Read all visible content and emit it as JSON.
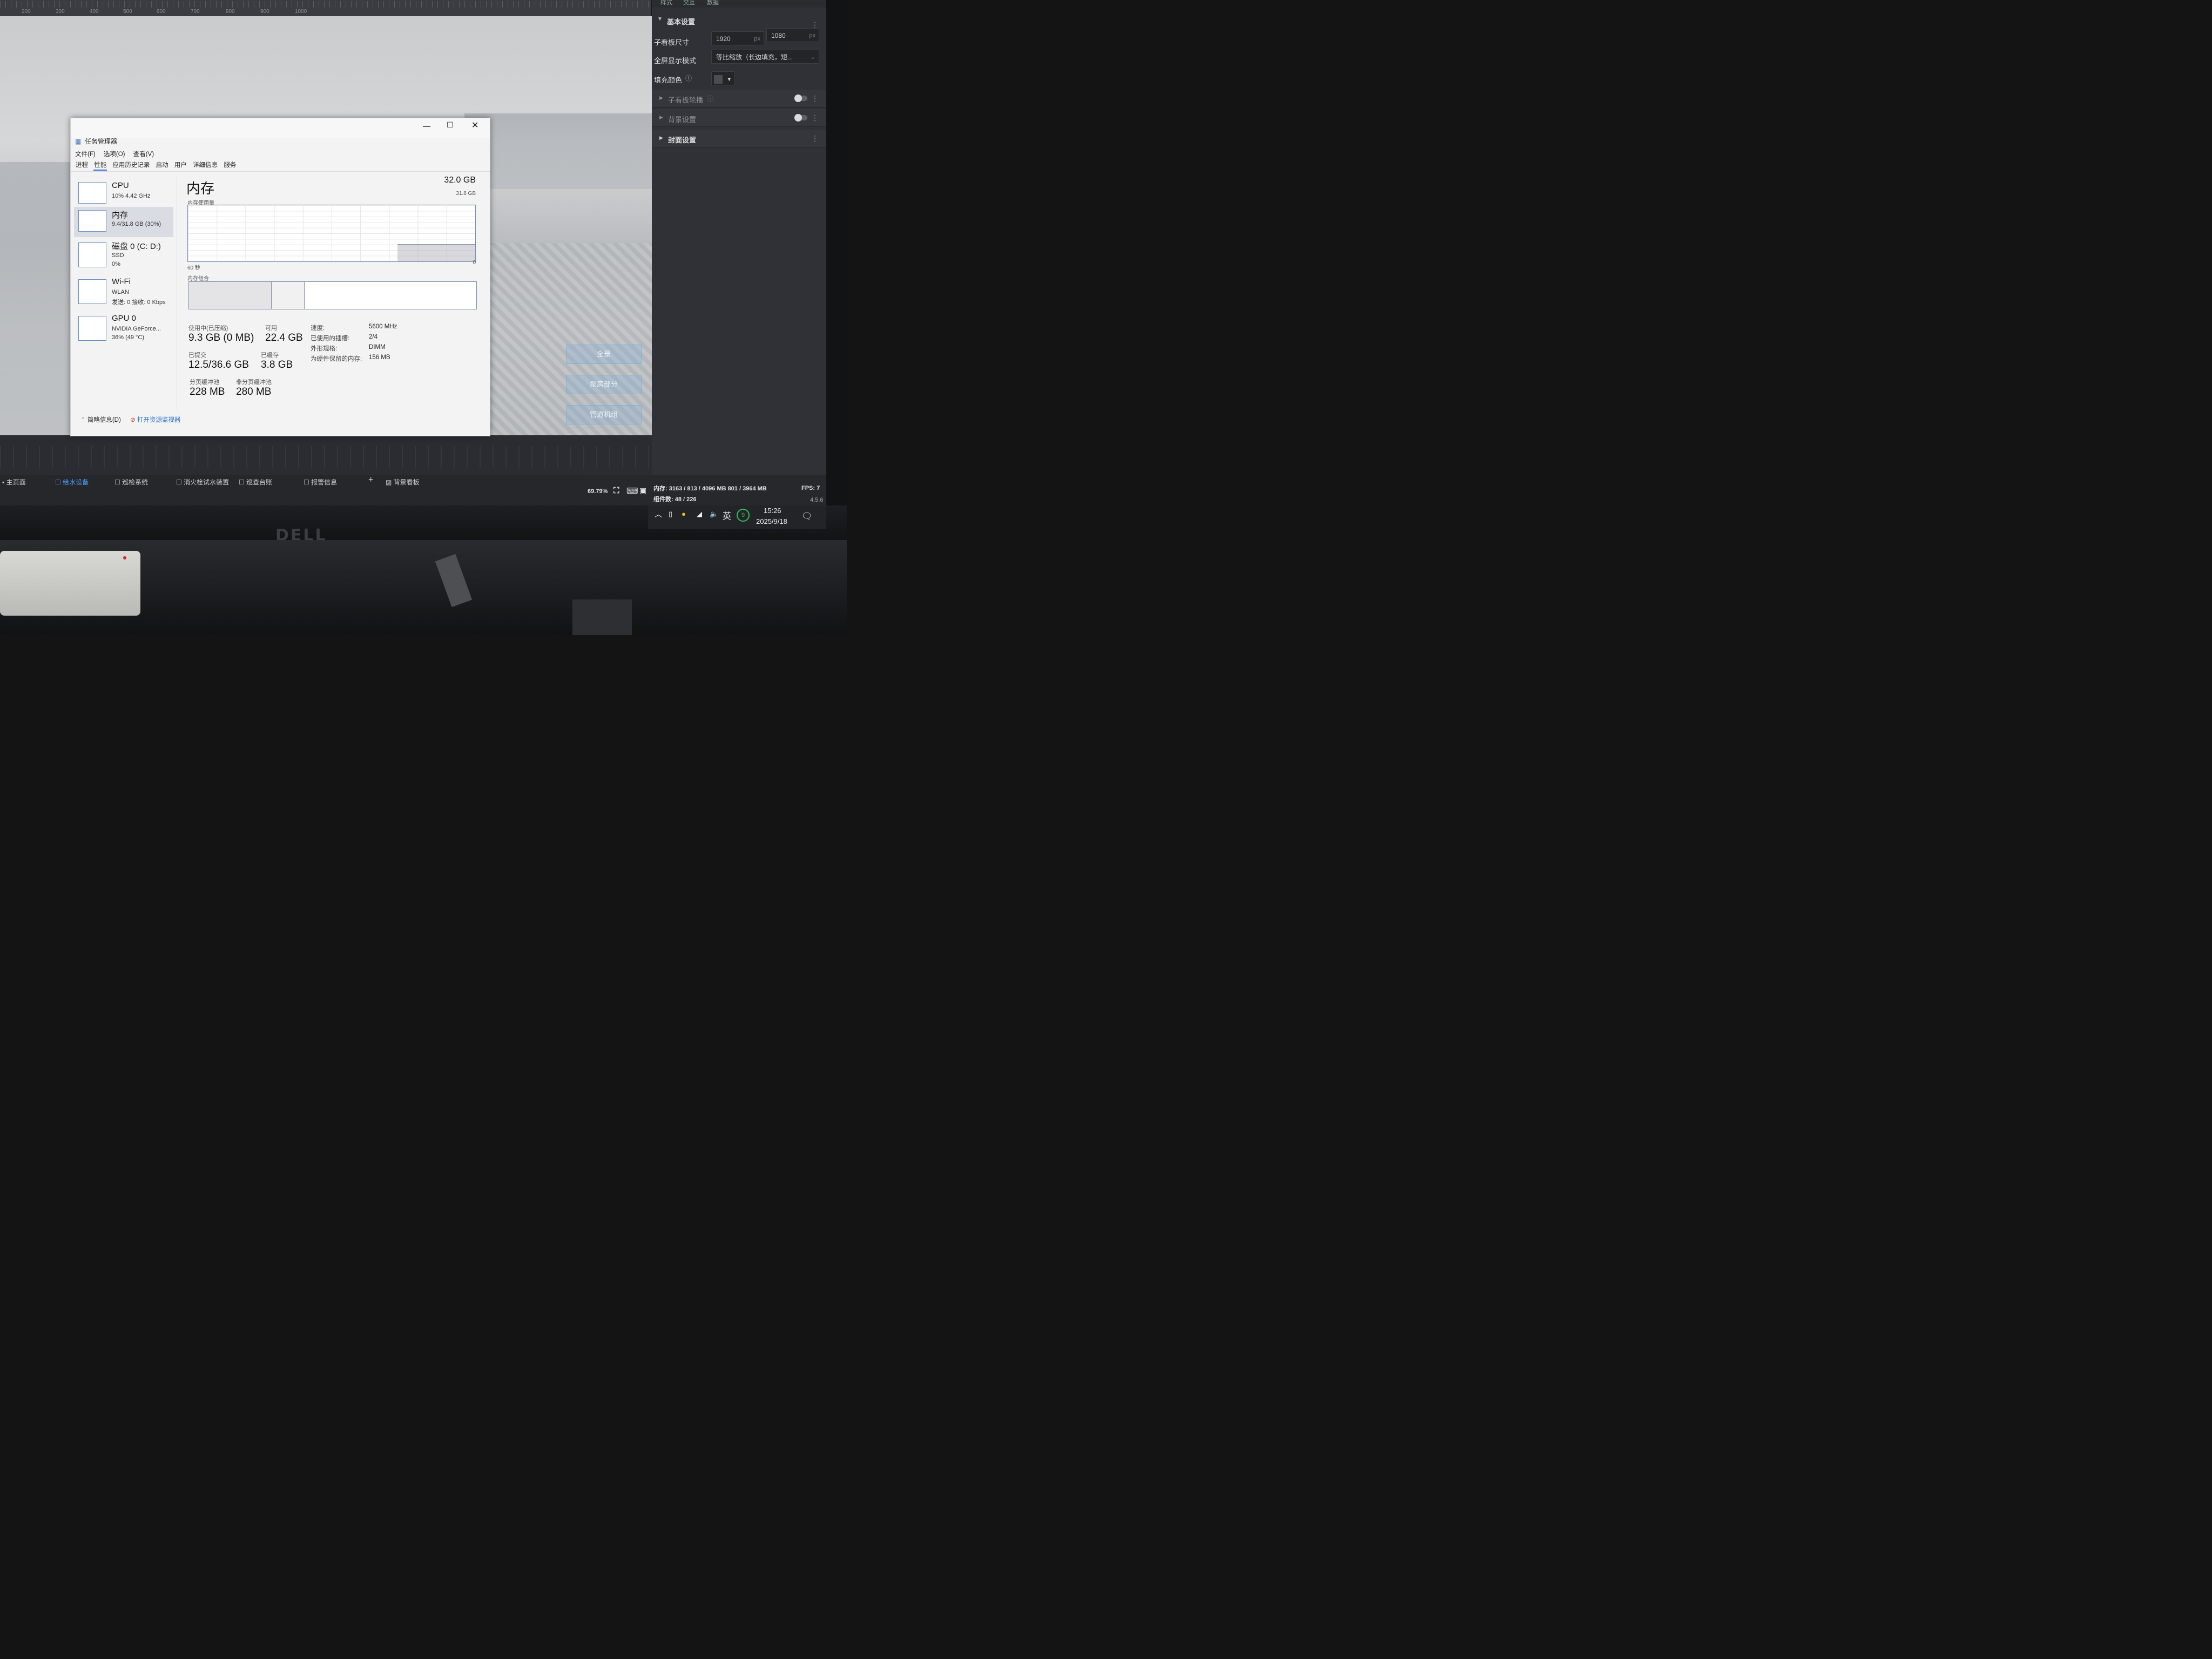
{
  "ruler": {
    "ticks": [
      "200",
      "300",
      "400",
      "500",
      "600",
      "700",
      "800",
      "900",
      "1000"
    ]
  },
  "panel": {
    "top_tabs": [
      "样式",
      "交互",
      "数据"
    ],
    "basic_section": "基本设置",
    "size_label": "子看板尺寸",
    "width": "1920",
    "height": "1080",
    "unit": "px",
    "fullscreen_label": "全屏显示模式",
    "fullscreen_value": "等比缩放（长边填充，短...",
    "fill_label": "填充颜色",
    "carousel_section": "子看板轮播",
    "background_section": "背景设置",
    "cover_section": "封面设置"
  },
  "canvas_buttons": [
    "全景",
    "泵房部分",
    "管道机组"
  ],
  "task_manager": {
    "title": "任务管理器",
    "menu": [
      "文件(F)",
      "选项(O)",
      "查看(V)"
    ],
    "tabs": [
      "进程",
      "性能",
      "应用历史记录",
      "启动",
      "用户",
      "详细信息",
      "服务"
    ],
    "active_tab": "性能",
    "sidebar": [
      {
        "name": "CPU",
        "sub1": "10%  4.42 GHz",
        "sub2": ""
      },
      {
        "name": "内存",
        "sub1": "9.4/31.8 GB (30%)",
        "sub2": ""
      },
      {
        "name": "磁盘 0 (C: D:)",
        "sub1": "SSD",
        "sub2": "0%"
      },
      {
        "name": "Wi-Fi",
        "sub1": "WLAN",
        "sub2": "发送: 0 接收: 0 Kbps"
      },
      {
        "name": "GPU 0",
        "sub1": "NVIDIA GeForce...",
        "sub2": "36% (49 °C)"
      }
    ],
    "main_title": "内存",
    "total": "32.0 GB",
    "usage_label": "内存使用量",
    "usage_max": "31.8 GB",
    "time_span": "60 秒",
    "zero": "0",
    "composition_label": "内存组合",
    "in_use_label": "使用中(已压缩)",
    "in_use_value": "9.3 GB (0 MB)",
    "available_label": "可用",
    "available_value": "22.4 GB",
    "committed_label": "已提交",
    "committed_value": "12.5/36.6 GB",
    "cached_label": "已缓存",
    "cached_value": "3.8 GB",
    "paged_label": "分页缓冲池",
    "paged_value": "228 MB",
    "nonpaged_label": "非分页缓冲池",
    "nonpaged_value": "280 MB",
    "specs": [
      {
        "k": "速度:",
        "v": "5600 MHz"
      },
      {
        "k": "已使用的插槽:",
        "v": "2/4"
      },
      {
        "k": "外形规格:",
        "v": "DIMM"
      },
      {
        "k": "为硬件保留的内存:",
        "v": "156 MB"
      }
    ],
    "footer_brief": "简略信息(D)",
    "footer_monitor": "打开资源监视器",
    "usage_fraction": 0.3
  },
  "app_tabs": [
    "主页面",
    "给水设备",
    "巡检系统",
    "消火栓试水装置",
    "巡查台账",
    "报警信息",
    "+",
    "背景看板"
  ],
  "active_app_tab": "给水设备",
  "status": {
    "zoom": "69.79%",
    "memory": "内存:  3163 / 813 / 4096 MB  801 / 3964 MB",
    "components": "组件数: 48 / 226",
    "fps": "FPS:  7",
    "version": "4.5.6"
  },
  "tray": {
    "ime": "英",
    "badge": "9",
    "time": "15:26",
    "date": "2025/9/18"
  },
  "brand": "DELL"
}
